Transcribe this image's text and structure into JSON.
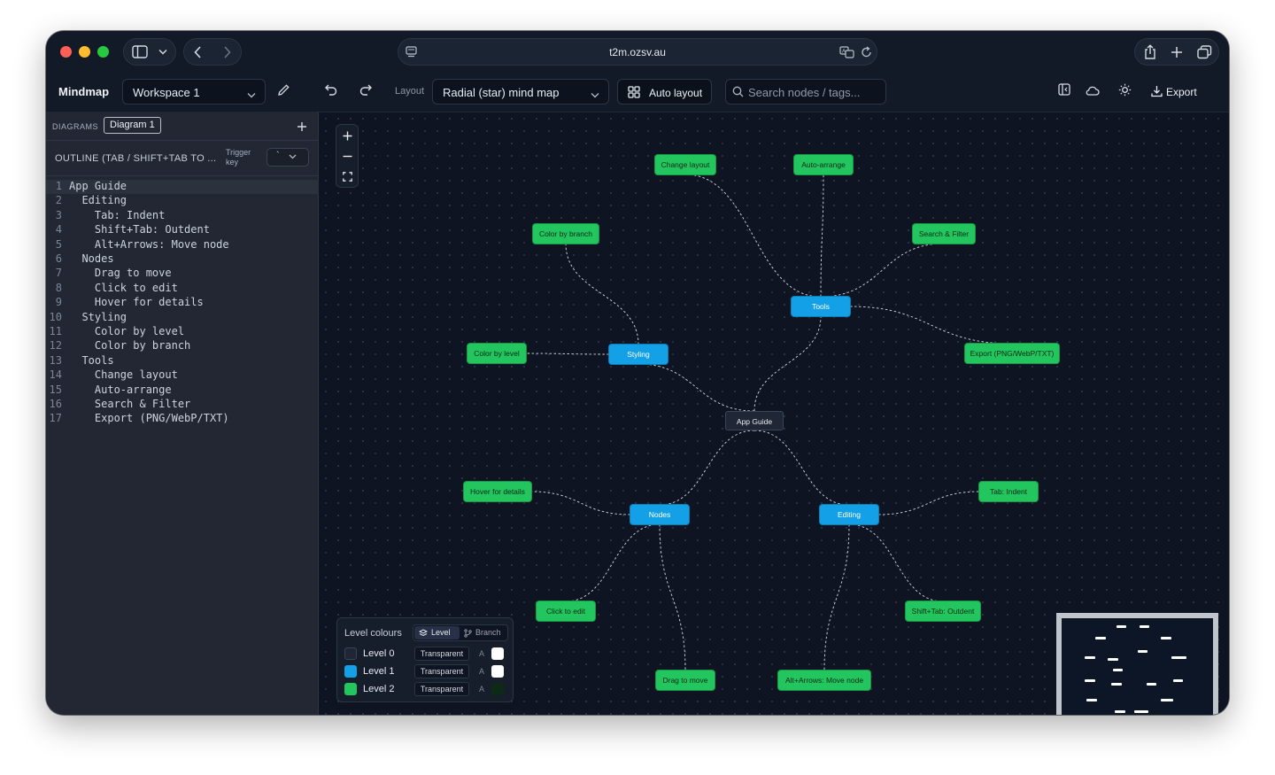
{
  "browser": {
    "url": "t2m.ozsv.au"
  },
  "toolbar": {
    "brand": "Mindmap",
    "workspace": "Workspace 1",
    "layout_label": "Layout",
    "layout_value": "Radial (star) mind map",
    "auto_layout": "Auto layout",
    "search_placeholder": "Search nodes / tags...",
    "export": "Export"
  },
  "sidebar": {
    "diagrams_label": "DIAGRAMS",
    "diagram_tab": "Diagram 1",
    "outline_label": "OUTLINE (TAB / SHIFT+TAB TO ...",
    "trigger_label": "Trigger key",
    "trigger_value": "`",
    "lines": [
      {
        "n": "1",
        "t": "App Guide"
      },
      {
        "n": "2",
        "t": "  Editing"
      },
      {
        "n": "3",
        "t": "    Tab: Indent"
      },
      {
        "n": "4",
        "t": "    Shift+Tab: Outdent"
      },
      {
        "n": "5",
        "t": "    Alt+Arrows: Move node"
      },
      {
        "n": "6",
        "t": "  Nodes"
      },
      {
        "n": "7",
        "t": "    Drag to move"
      },
      {
        "n": "8",
        "t": "    Click to edit"
      },
      {
        "n": "9",
        "t": "    Hover for details"
      },
      {
        "n": "10",
        "t": "  Styling"
      },
      {
        "n": "11",
        "t": "    Color by level"
      },
      {
        "n": "12",
        "t": "    Color by branch"
      },
      {
        "n": "13",
        "t": "  Tools"
      },
      {
        "n": "14",
        "t": "    Change layout"
      },
      {
        "n": "15",
        "t": "    Auto-arrange"
      },
      {
        "n": "16",
        "t": "    Search & Filter"
      },
      {
        "n": "17",
        "t": "    Export (PNG/WebP/TXT)"
      }
    ]
  },
  "mindmap": {
    "nodes": {
      "root": "App Guide",
      "editing": "Editing",
      "nodes": "Nodes",
      "styling": "Styling",
      "tools": "Tools",
      "tab_indent": "Tab: Indent",
      "shift_tab": "Shift+Tab: Outdent",
      "alt_arrows": "Alt+Arrows: Move node",
      "drag": "Drag to move",
      "click": "Click to edit",
      "hover": "Hover for details",
      "color_level": "Color by level",
      "color_branch": "Color by branch",
      "change_layout": "Change layout",
      "auto_arrange": "Auto-arrange",
      "search_filter": "Search & Filter",
      "export": "Export (PNG/WebP/TXT)"
    },
    "colors": {
      "level0": "#1f2636",
      "level1": "#14a0e6",
      "level2": "#22c55e"
    }
  },
  "legend": {
    "title": "Level colours",
    "mode_level": "Level",
    "mode_branch": "Branch",
    "rows": [
      {
        "name": "Level 0",
        "fill": "Transparent",
        "alpha": "A",
        "swatch": "#1f2636",
        "text_color": "#ffffff"
      },
      {
        "name": "Level 1",
        "fill": "Transparent",
        "alpha": "A",
        "swatch": "#14a0e6",
        "text_color": "#ffffff"
      },
      {
        "name": "Level 2",
        "fill": "Transparent",
        "alpha": "A",
        "swatch": "#22c55e",
        "text_color": "#0d2a16"
      }
    ]
  }
}
